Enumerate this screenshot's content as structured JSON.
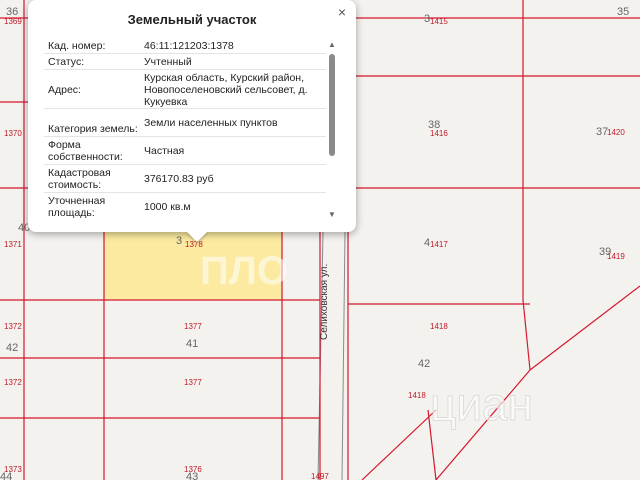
{
  "map": {
    "street_name": "Селиховская ул.",
    "watermark_top": "ПЛО",
    "watermark_brand": "циан",
    "parcel_numbers": {
      "p1369": "1369",
      "p1370": "1370",
      "p1371": "1371",
      "p1372a": "1372",
      "p1372b": "1372",
      "p1373": "1373",
      "p1378": "1378",
      "p1377a": "1377",
      "p1377b": "1377",
      "p1376": "1376",
      "p1415": "1415",
      "p1416": "1416",
      "p1417": "1417",
      "p1418a": "1418",
      "p1418b": "1418",
      "p1419": "1419",
      "p1420": "1420",
      "p1497": "1497"
    },
    "house_numbers": {
      "h36": "36",
      "h35": "35",
      "h40": "40",
      "h42": "42",
      "h41": "41",
      "h43": "43",
      "h44": "44",
      "h38": "38",
      "h37": "37",
      "h39": "39",
      "h42b": "42",
      "h3x": "3",
      "h4x": "4",
      "h3y": "3",
      "h3z": "3"
    },
    "colors": {
      "boundary": "#d6172e",
      "selected_fill": "#fbeaa0",
      "road": "#8a8a8a",
      "background": "#f4f2ee"
    }
  },
  "popup": {
    "title": "Земельный участок",
    "close_icon": "×",
    "rows": [
      {
        "key": "Кад. номер:",
        "value": "46:11:121203:1378"
      },
      {
        "key": "Статус:",
        "value": "Учтенный"
      },
      {
        "key": "Адрес:",
        "value": "Курская область, Курский район, Новопоселеновский сельсовет, д. Кукуевка"
      },
      {
        "key": "Категория земель:",
        "value": "Земли населенных пунктов"
      },
      {
        "key": "Форма собственности:",
        "value": "Частная"
      },
      {
        "key": "Кадастровая стоимость:",
        "value": "376170.83 руб"
      },
      {
        "key": "Уточненная площадь:",
        "value": "1000 кв.м"
      }
    ]
  }
}
